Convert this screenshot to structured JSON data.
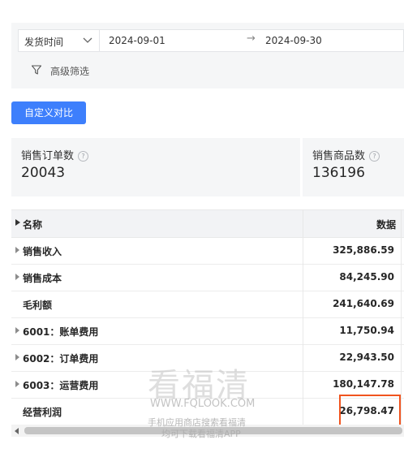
{
  "filters": {
    "date_type_label": "发货时间",
    "date_start": "2024-09-01",
    "date_arrow": "→",
    "date_end": "2024-09-30",
    "advanced_filter_label": "高级筛选"
  },
  "compare_button_label": "自定义对比",
  "stats": [
    {
      "title": "销售订单数",
      "help": "?",
      "value": "20043"
    },
    {
      "title": "销售商品数",
      "help": "?",
      "value": "136196"
    }
  ],
  "table": {
    "headers": {
      "name": "名称",
      "data": "数据"
    },
    "rows": [
      {
        "name": "销售收入",
        "value": "325,886.59",
        "expandable": true
      },
      {
        "name": "销售成本",
        "value": "84,245.90",
        "expandable": true
      },
      {
        "name": "毛利额",
        "value": "241,640.69",
        "expandable": false
      },
      {
        "name": "6001：账单费用",
        "value": "11,750.94",
        "expandable": true
      },
      {
        "name": "6002：订单费用",
        "value": "22,943.50",
        "expandable": true
      },
      {
        "name": "6003：运营费用",
        "value": "180,147.78",
        "expandable": true
      },
      {
        "name": "经营利润",
        "value": "26,798.47",
        "expandable": false
      }
    ]
  },
  "highlight_color": "#f0541e",
  "accent_color": "#3d7ffc",
  "watermark": {
    "logo": "看福清",
    "url": "WWW.FQLOOK.COM",
    "line1": "手机应用商店搜索看福清",
    "line2": "均可下载看福清APP"
  }
}
